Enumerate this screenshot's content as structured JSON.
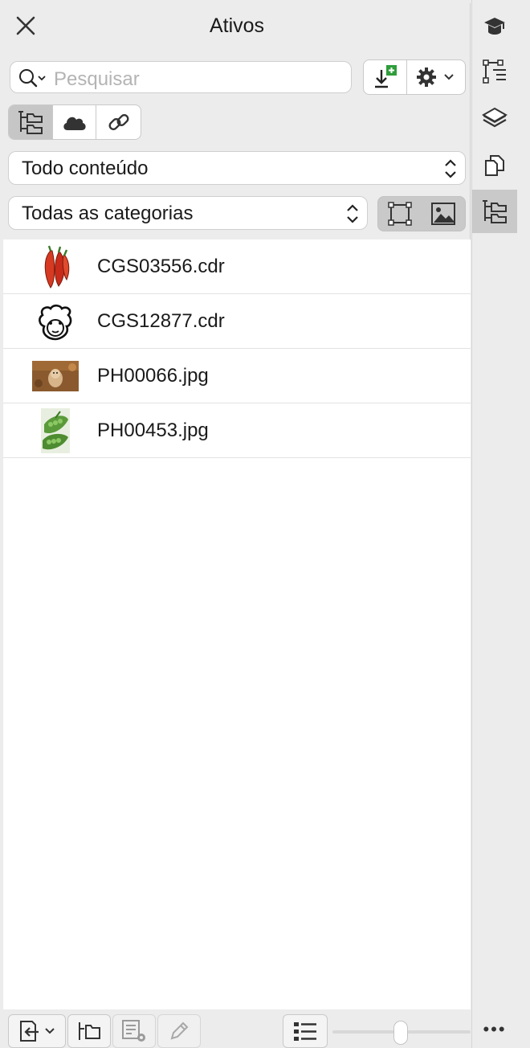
{
  "panel": {
    "title": "Ativos",
    "search": {
      "placeholder": "Pesquisar"
    },
    "content_filter": {
      "selected": "Todo conteúdo"
    },
    "category_filter": {
      "selected": "Todas as categorias"
    }
  },
  "files": [
    {
      "name": "CGS03556.cdr",
      "thumb": "chili-peppers"
    },
    {
      "name": "CGS12877.cdr",
      "thumb": "sheep-face"
    },
    {
      "name": "PH00066.jpg",
      "thumb": "dog-photo"
    },
    {
      "name": "PH00453.jpg",
      "thumb": "peas-photo"
    }
  ],
  "right_strip": {
    "icons": [
      "graduation-cap-icon",
      "object-tree-icon",
      "layers-icon",
      "pages-icon",
      "assets-icon"
    ],
    "active": "assets-icon",
    "more": "•••"
  },
  "colors": {
    "panel_bg": "#ececec",
    "list_bg": "#ffffff",
    "active_btn": "#c6c6c6",
    "accent_green": "#2e9d3a"
  }
}
